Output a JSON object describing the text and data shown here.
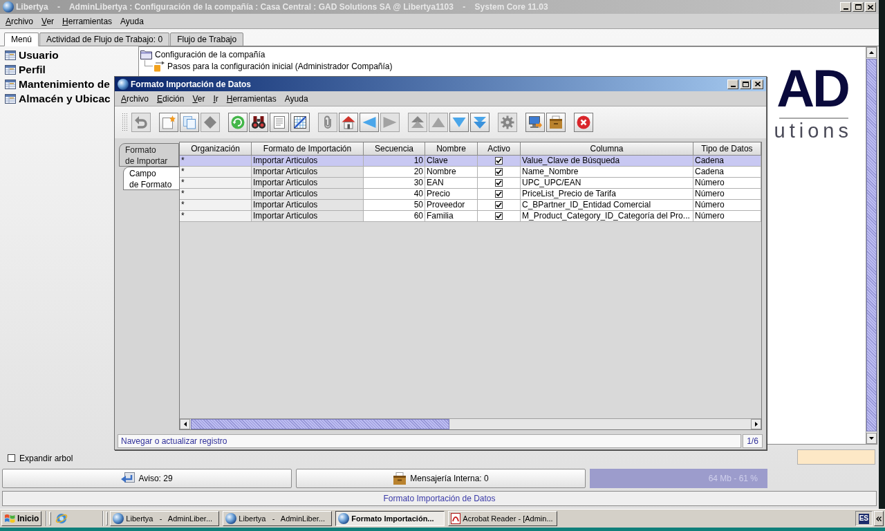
{
  "window": {
    "title": "Libertya    -    AdminLibertya : Configuración de la compañía : Casa Central : GAD Solutions SA @ Libertya1103    -    System Core 11.03"
  },
  "menu": [
    {
      "label": "Archivo",
      "mnemonic": true
    },
    {
      "label": "Ver",
      "mnemonic": true
    },
    {
      "label": "Herramientas",
      "mnemonic": true
    },
    {
      "label": "Ayuda",
      "mnemonic": false
    }
  ],
  "tabs": [
    {
      "label": "Menú",
      "selected": true
    },
    {
      "label": "Actividad de Flujo de Trabajo: 0",
      "selected": false
    },
    {
      "label": "Flujo de Trabajo",
      "selected": false
    }
  ],
  "sidebar": {
    "items": [
      {
        "label": "Usuario"
      },
      {
        "label": "Perfil"
      },
      {
        "label": "Mantenimiento de"
      },
      {
        "label": "Almacén y Ubicac"
      }
    ]
  },
  "tree": [
    {
      "label": "Configuración de la compañía",
      "kind": "folder",
      "children": [
        {
          "label": "Pasos para la configuración inicial (Administrador Compañía)",
          "kind": "workflow"
        }
      ]
    }
  ],
  "logo": {
    "lettering": "AD",
    "tagline": "utions"
  },
  "expand_tree": {
    "label": "Expandir arbol",
    "checked": false
  },
  "status_buttons": [
    {
      "kind": "notice",
      "label": "Aviso: 29"
    },
    {
      "kind": "messages",
      "label": "Mensajería Interna: 0"
    }
  ],
  "memory": {
    "reading": "64 Mb - 61 %"
  },
  "status_bar": {
    "text": "Formato Importación de Datos"
  },
  "dialog": {
    "title": "Formato Importación de Datos",
    "menu": [
      {
        "label": "Archivo",
        "mnemonic": true
      },
      {
        "label": "Edición",
        "mnemonic": true
      },
      {
        "label": "Ver",
        "mnemonic": true
      },
      {
        "label": "Ir",
        "mnemonic": true
      },
      {
        "label": "Herramientas",
        "mnemonic": true
      },
      {
        "label": "Ayuda",
        "mnemonic": false
      }
    ],
    "toolbar": [
      [
        {
          "kind": "undo",
          "disabled": true
        }
      ],
      [
        {
          "kind": "new",
          "disabled": false
        },
        {
          "kind": "copy",
          "disabled": false
        },
        {
          "kind": "delete",
          "disabled": true
        }
      ],
      [
        {
          "kind": "refresh",
          "disabled": false
        },
        {
          "kind": "find",
          "disabled": false
        },
        {
          "kind": "report",
          "disabled": false
        },
        {
          "kind": "grid",
          "disabled": false
        }
      ],
      [
        {
          "kind": "attachment",
          "disabled": true
        },
        {
          "kind": "home",
          "disabled": false
        },
        {
          "kind": "back",
          "disabled": false
        },
        {
          "kind": "forward",
          "disabled": true
        }
      ],
      [
        {
          "kind": "first",
          "disabled": true
        },
        {
          "kind": "previous",
          "disabled": true
        },
        {
          "kind": "next",
          "disabled": false
        },
        {
          "kind": "last",
          "disabled": false
        }
      ],
      [
        {
          "kind": "info",
          "disabled": true
        }
      ],
      [
        {
          "kind": "export",
          "disabled": false
        },
        {
          "kind": "archive",
          "disabled": false
        }
      ],
      [
        {
          "kind": "close",
          "disabled": false
        }
      ]
    ],
    "side_tabs": [
      {
        "label": "Formato\nde Importar",
        "selected": false
      },
      {
        "label": "Campo\nde Formato",
        "selected": true
      }
    ],
    "table": {
      "columns": [
        "Organización",
        "Formato de Importación",
        "Secuencia",
        "Nombre",
        "Activo",
        "Columna",
        "Tipo de Datos"
      ],
      "rows": [
        {
          "organization": "*",
          "import_format": "Importar Articulos",
          "sequence": "10",
          "name": "Clave",
          "active": true,
          "column": "Value_Clave de Búsqueda",
          "data_type": "Cadena",
          "selected": true
        },
        {
          "organization": "*",
          "import_format": "Importar Articulos",
          "sequence": "20",
          "name": "Nombre",
          "active": true,
          "column": "Name_Nombre",
          "data_type": "Cadena",
          "selected": false
        },
        {
          "organization": "*",
          "import_format": "Importar Articulos",
          "sequence": "30",
          "name": "EAN",
          "active": true,
          "column": "UPC_UPC/EAN",
          "data_type": "Número",
          "selected": false
        },
        {
          "organization": "*",
          "import_format": "Importar Articulos",
          "sequence": "40",
          "name": "Precio",
          "active": true,
          "column": "PriceList_Precio de Tarifa",
          "data_type": "Número",
          "selected": false
        },
        {
          "organization": "*",
          "import_format": "Importar Articulos",
          "sequence": "50",
          "name": "Proveedor",
          "active": true,
          "column": "C_BPartner_ID_Entidad Comercial",
          "data_type": "Número",
          "selected": false
        },
        {
          "organization": "*",
          "import_format": "Importar Articulos",
          "sequence": "60",
          "name": "Familia",
          "active": true,
          "column": "M_Product_Category_ID_Categoría del Pro...",
          "data_type": "Número",
          "selected": false
        }
      ]
    },
    "status": {
      "message": "Navegar o actualizar registro",
      "count": "1/6"
    }
  },
  "taskbar": {
    "start": "Inicio",
    "tasks": [
      {
        "kind": "app",
        "label": "Libertya   -   AdminLiber...",
        "selected": false
      },
      {
        "kind": "app",
        "label": "Libertya   -   AdminLiber...",
        "selected": false
      },
      {
        "kind": "app",
        "label": "Formato Importación...",
        "selected": true
      },
      {
        "kind": "pdf",
        "label": "Acrobat Reader - [Admin...",
        "selected": false
      }
    ],
    "language": "ES"
  }
}
